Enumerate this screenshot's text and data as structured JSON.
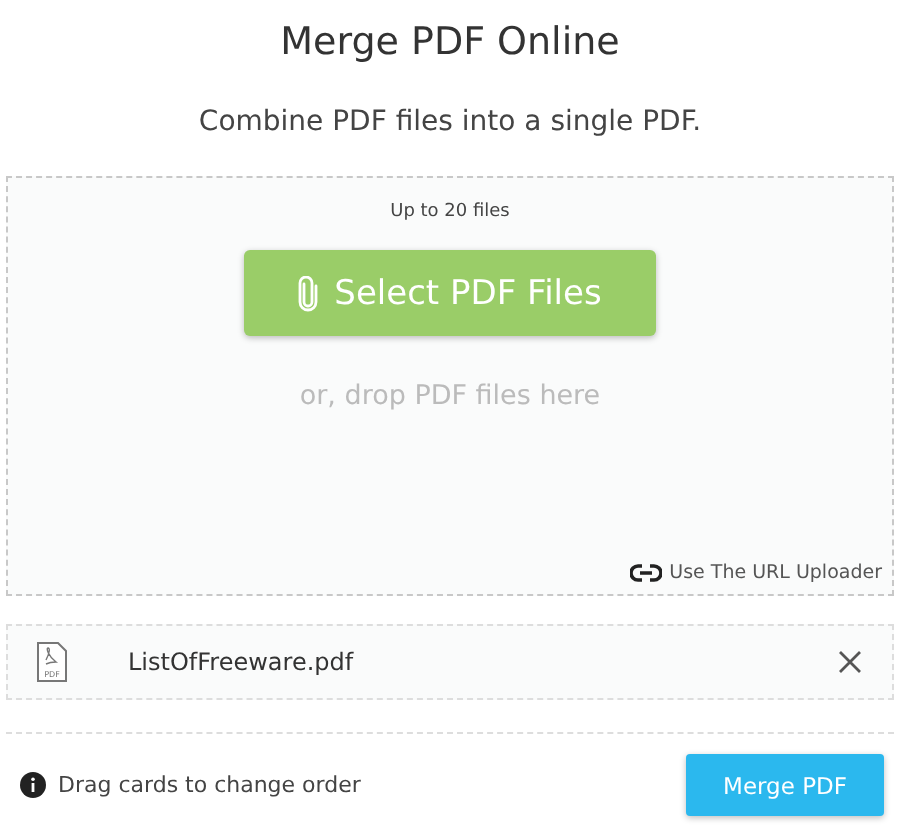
{
  "title": "Merge PDF Online",
  "subtitle": "Combine PDF files into a single PDF.",
  "dropzone": {
    "limit": "Up to 20 files",
    "select_button": "Select PDF Files",
    "drop_hint": "or, drop PDF files here",
    "url_link": "Use The URL Uploader"
  },
  "files": [
    {
      "icon_label": "PDF",
      "name": "ListOfFreeware.pdf"
    }
  ],
  "footer": {
    "hint": "Drag cards to change order",
    "merge_button": "Merge PDF"
  }
}
